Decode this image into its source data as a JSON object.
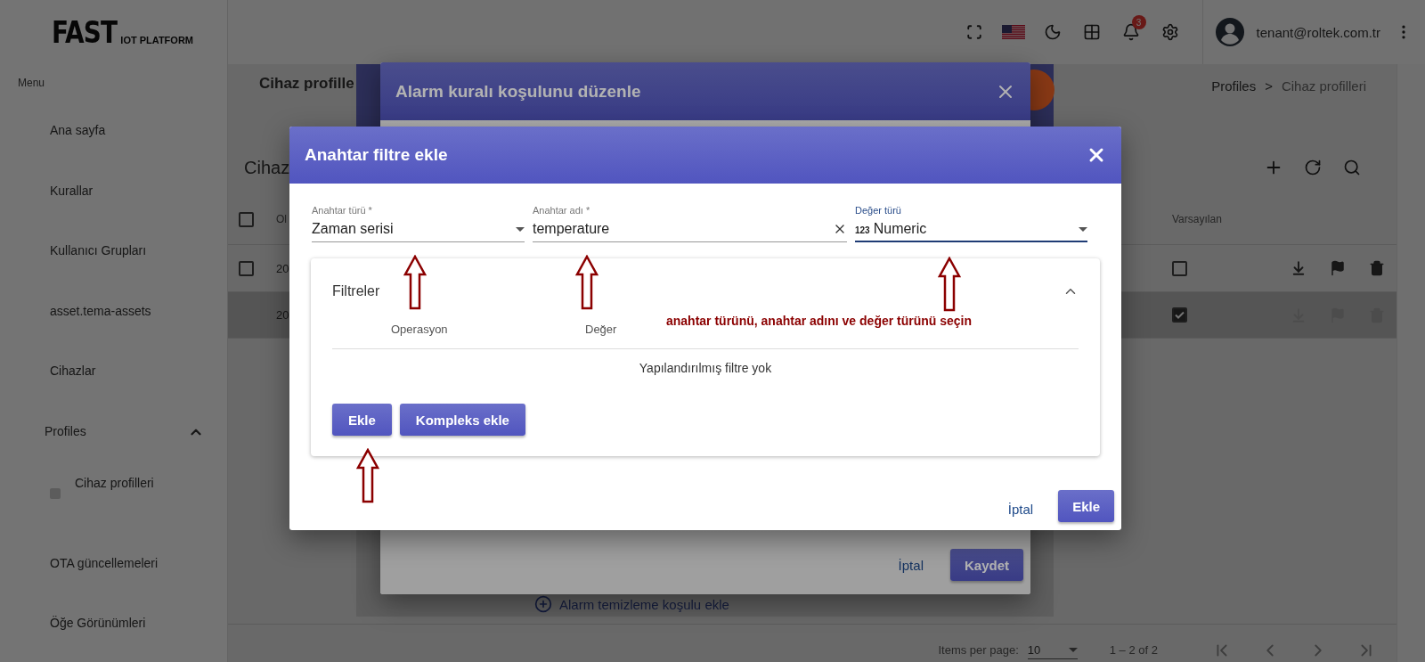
{
  "logo": {
    "main": "FAST",
    "sub": "IOT PLATFORM"
  },
  "sidebar": {
    "menu_label": "Menu",
    "items": [
      {
        "label": "Ana sayfa"
      },
      {
        "label": "Kurallar"
      },
      {
        "label": "Kullanıcı Grupları"
      },
      {
        "label": "asset.tema-assets"
      },
      {
        "label": "Cihazlar"
      },
      {
        "label": "Profiles",
        "expanded": true,
        "children": [
          {
            "label": "Cihaz profilleri"
          }
        ]
      },
      {
        "label": "OTA güncellemeleri"
      },
      {
        "label": "Öğe Görünümleri"
      }
    ]
  },
  "header": {
    "notification_count": "3",
    "user_email": "tenant@roltek.com.tr"
  },
  "page": {
    "title": "Cihaz profille",
    "breadcrumb": [
      "Profiles",
      "Cihaz profilleri"
    ],
    "breadcrumb_separator": ">"
  },
  "card": {
    "title": "Cihaz",
    "all_selected": false,
    "columns": [
      "Ol",
      "Varsayılan"
    ],
    "rows": [
      {
        "column_1": "20",
        "checked": false,
        "default": false,
        "selected": false,
        "actions_disabled": false
      },
      {
        "column_1": "20",
        "default": true,
        "selected": true,
        "actions_disabled": true
      }
    ]
  },
  "pagination": {
    "label": "Items per page:",
    "page_size": "10",
    "range": "1 – 2 of 2"
  },
  "alarm_dialog": {
    "title": "Alarm kuralı koşulunu düzenle",
    "cancel": "İptal",
    "save": "Kaydet",
    "clear_condition": "Alarm temizleme koşulu ekle"
  },
  "filter_dialog": {
    "title": "Anahtar filtre ekle",
    "fields": [
      {
        "kind": "select",
        "label": "Anahtar türü *",
        "value": "Zaman serisi",
        "focused": false
      },
      {
        "kind": "clearable",
        "label": "Anahtar adı *",
        "value": "temperature",
        "focused": false
      },
      {
        "kind": "select",
        "label": "Değer türü",
        "value_icon": "123",
        "value": "Numeric",
        "focused": true
      }
    ],
    "filters": {
      "title": "Filtreler",
      "expanded": true,
      "columns": [
        "Operasyon",
        "Değer"
      ],
      "empty": "Yapılandırılmış filtre yok",
      "buttons": [
        "Ekle",
        "Kompleks ekle"
      ]
    },
    "cancel": "İptal",
    "submit": "Ekle"
  },
  "annotation": {
    "text": "anahtar türünü, anahtar adını ve değer türünü seçin"
  }
}
